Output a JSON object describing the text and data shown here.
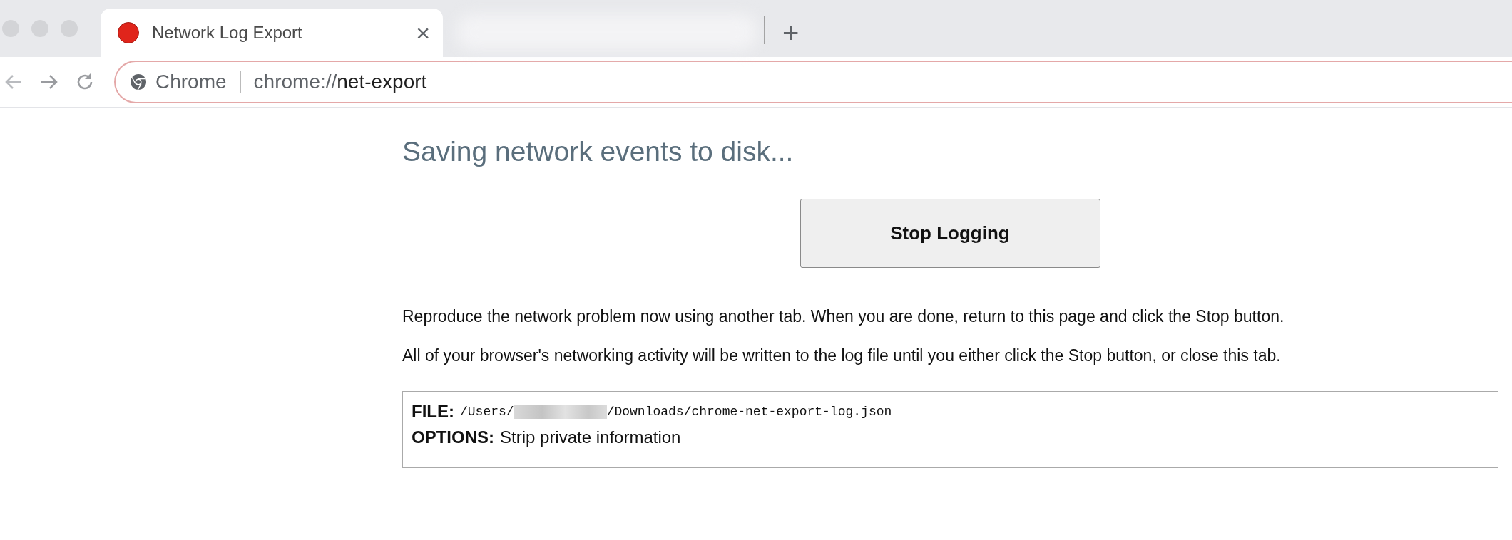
{
  "tabs": [
    {
      "title": "Network Log Export",
      "selected": true,
      "close": "×"
    }
  ],
  "new_tab": "+",
  "address_bar": {
    "site_label": "Chrome",
    "url_scheme": "chrome://",
    "url_host": "net-export"
  },
  "page": {
    "heading": "Saving network events to disk...",
    "button": "Stop Logging",
    "paragraphs": [
      "Reproduce the network problem now using another tab. When you are done, return to this page and click the Stop button.",
      "All of your browser's networking activity will be written to the log file until you either click the Stop button, or close this tab."
    ],
    "info": {
      "file_label": "FILE:",
      "file_path_start": "/Users/",
      "file_path_end": "/Downloads/chrome-net-export-log.json",
      "options_label": "OPTIONS:",
      "options_value": "Strip private information"
    }
  }
}
